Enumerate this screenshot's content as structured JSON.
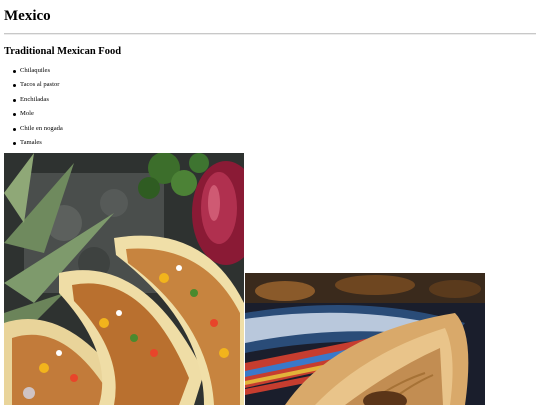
{
  "page": {
    "title": "Mexico"
  },
  "section": {
    "title": "Traditional Mexican Food",
    "items": [
      {
        "label": "Chilaquiles"
      },
      {
        "label": "Tacos al pastor"
      },
      {
        "label": "Enchiladas"
      },
      {
        "label": "Mole"
      },
      {
        "label": "Chile en nogada"
      },
      {
        "label": "Tamales"
      }
    ]
  },
  "images": {
    "tacos": {
      "subject": "tacos-photo"
    },
    "tamales": {
      "subject": "tamales-photo"
    }
  }
}
